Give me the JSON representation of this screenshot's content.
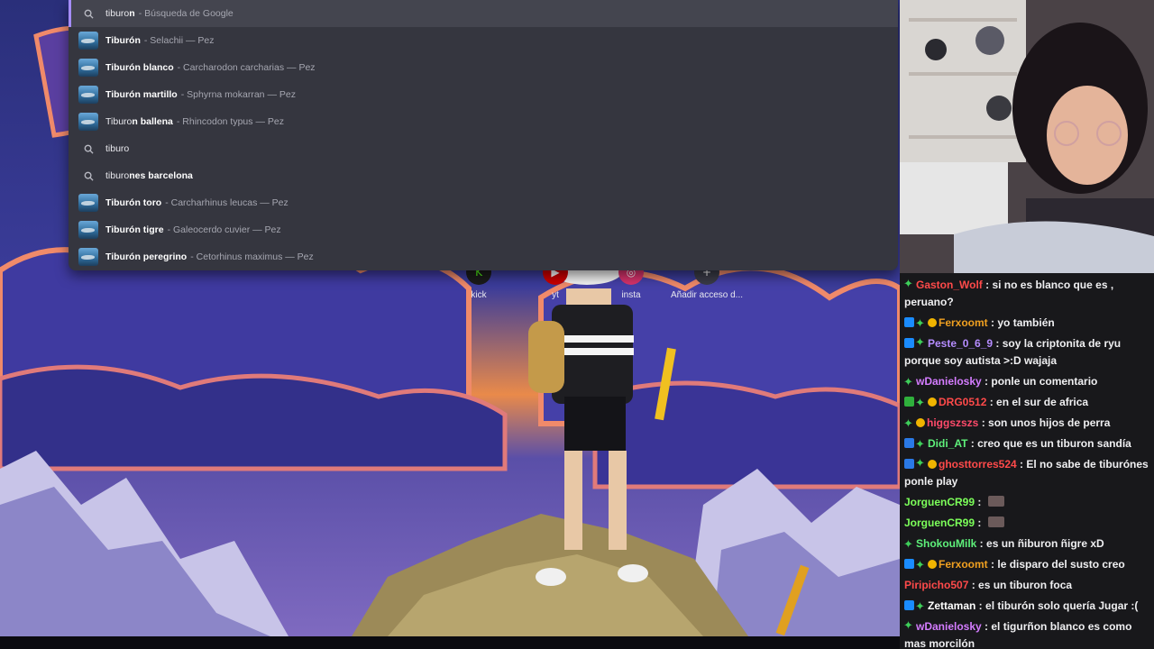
{
  "omnibox": {
    "suggestions": [
      {
        "kind": "search",
        "title_bold_prefix": "tiburo",
        "title_rest": "n",
        "subtitle": "- Búsqueda de Google",
        "icon": "search-icon"
      },
      {
        "kind": "entity",
        "title": "Tiburón",
        "subtitle": "- Selachii — Pez",
        "icon": "shark-thumbnail"
      },
      {
        "kind": "entity",
        "title": "Tiburón blanco",
        "subtitle": "- Carcharodon carcharias — Pez",
        "icon": "shark-thumbnail"
      },
      {
        "kind": "entity",
        "title": "Tiburón martillo",
        "subtitle": "- Sphyrna mokarran — Pez",
        "icon": "shark-thumbnail"
      },
      {
        "kind": "entity",
        "title_prefix": "Tiburo",
        "title": "n ballena",
        "subtitle": "- Rhincodon typus — Pez",
        "icon": "shark-thumbnail"
      },
      {
        "kind": "search",
        "title_plain": "tiburo",
        "icon": "search-icon"
      },
      {
        "kind": "search",
        "title_prefix": "tiburo",
        "title": "nes barcelona",
        "icon": "search-icon"
      },
      {
        "kind": "entity",
        "title": "Tiburón toro",
        "subtitle": "- Carcharhinus leucas — Pez",
        "icon": "shark-thumbnail"
      },
      {
        "kind": "entity",
        "title": "Tiburón tigre",
        "subtitle": "- Galeocerdo cuvier — Pez",
        "icon": "shark-thumbnail"
      },
      {
        "kind": "entity",
        "title": "Tiburón peregrino",
        "subtitle": "- Cetorhinus maximus — Pez",
        "icon": "shark-thumbnail"
      }
    ],
    "accent_color": "#a58cff"
  },
  "shortcuts": [
    {
      "label": "kick",
      "icon": "kick-icon",
      "color": "#53fc18"
    },
    {
      "label": "yt",
      "icon": "youtube-icon",
      "color": "#ff0000"
    },
    {
      "label": "insta",
      "icon": "instagram-icon",
      "color": "#e1306c"
    },
    {
      "label": "Añadir acceso d...",
      "icon": "plus-icon",
      "color": "#3a3b48"
    }
  ],
  "chat": {
    "messages": [
      {
        "badges": [
          "dia"
        ],
        "user": "Gaston_Wolf",
        "color": "#ff4a4a",
        "text": "si no es blanco que es , peruano?"
      },
      {
        "badges": [
          "vip",
          "dia",
          "gold"
        ],
        "user": "Ferxoomt",
        "color": "#f0a020",
        "text": "yo también"
      },
      {
        "badges": [
          "vip",
          "dia"
        ],
        "user": "Peste_0_6_9",
        "color": "#b58cff",
        "text": "soy la criptonita de ryu porque soy autista >:D wajaja"
      },
      {
        "badges": [
          "dia"
        ],
        "user": "wDanielosky",
        "color": "#d47cff",
        "text": "ponle un comentario"
      },
      {
        "badges": [
          "cube",
          "dia",
          "gold"
        ],
        "user": "DRG0512",
        "color": "#ff4a4a",
        "text": "en el sur de africa"
      },
      {
        "badges": [
          "dia",
          "gold"
        ],
        "user": "higgszszs",
        "color": "#ff4a6a",
        "text": "son unos hijos de perra"
      },
      {
        "badges": [
          "blue",
          "dia"
        ],
        "user": "Didi_AT",
        "color": "#5ef07a",
        "text": "creo que es un tiburon sandía"
      },
      {
        "badges": [
          "blue",
          "dia",
          "gold"
        ],
        "user": "ghosttorres524",
        "color": "#ff4a4a",
        "text": "El no sabe de tiburónes ponle play"
      },
      {
        "badges": [],
        "user": "JorguenCR99",
        "color": "#7cff5a",
        "text": "",
        "emote": true
      },
      {
        "badges": [],
        "user": "JorguenCR99",
        "color": "#7cff5a",
        "text": "",
        "emote": true
      },
      {
        "badges": [
          "dia"
        ],
        "user": "ShokouMilk",
        "color": "#5ef07a",
        "text": "es un ñiburon ñigre xD"
      },
      {
        "badges": [
          "vip",
          "dia",
          "gold"
        ],
        "user": "Ferxoomt",
        "color": "#f0a020",
        "text": "le disparo del susto creo"
      },
      {
        "badges": [],
        "user": "Piripicho507",
        "color": "#ff4a4a",
        "text": "es un tiburon foca"
      },
      {
        "badges": [
          "vip",
          "dia"
        ],
        "user": "Zettaman",
        "color": "#ffffff",
        "text": "el tiburón solo quería Jugar :("
      },
      {
        "badges": [
          "dia"
        ],
        "user": "wDanielosky",
        "color": "#d47cff",
        "text": "el tigurñon blanco es como mas morcilón"
      }
    ]
  }
}
